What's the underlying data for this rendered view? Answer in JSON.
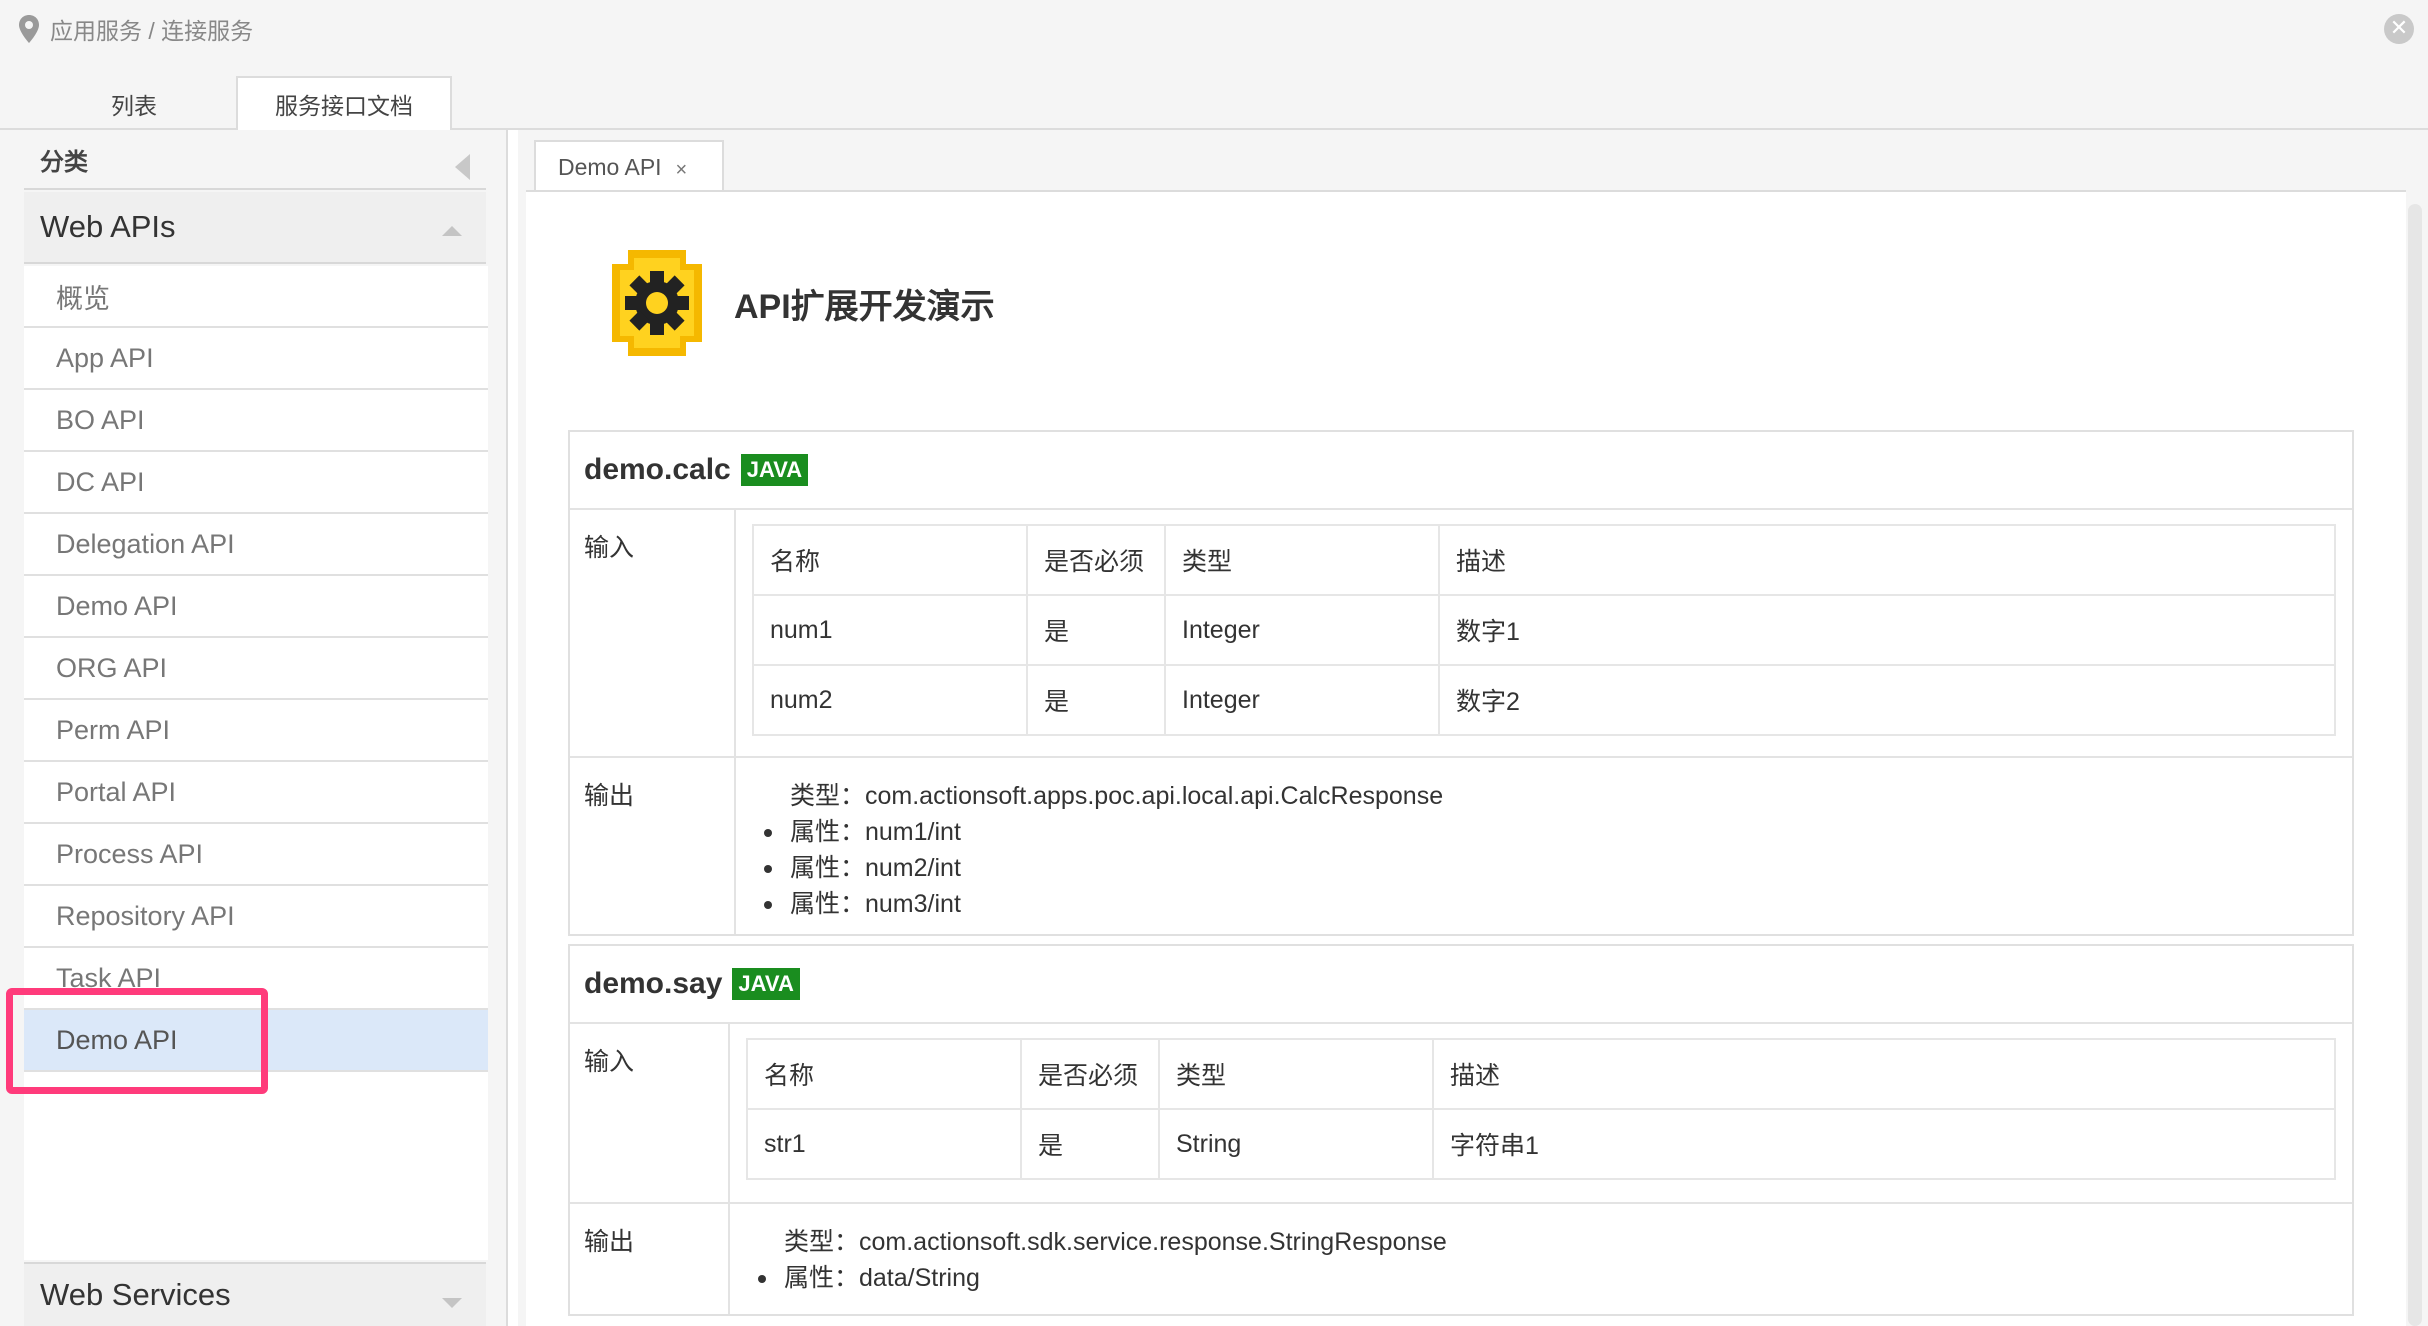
{
  "breadcrumb": {
    "text": "应用服务 / 连接服务",
    "icon": "location-pin-icon"
  },
  "window": {
    "close_icon": "close-circle-icon"
  },
  "tabs": [
    {
      "label": "列表"
    },
    {
      "label": "服务接口文档"
    }
  ],
  "sidebar": {
    "category_title": "分类",
    "group_open": "Web APIs",
    "items": [
      {
        "label": "概览"
      },
      {
        "label": "App API"
      },
      {
        "label": "BO API"
      },
      {
        "label": "DC API"
      },
      {
        "label": "Delegation API"
      },
      {
        "label": "Demo API"
      },
      {
        "label": "ORG API"
      },
      {
        "label": "Perm API"
      },
      {
        "label": "Portal API"
      },
      {
        "label": "Process API"
      },
      {
        "label": "Repository API"
      },
      {
        "label": "Task API"
      },
      {
        "label": "Demo API"
      }
    ],
    "selected_index": 12,
    "group_closed": "Web Services"
  },
  "content": {
    "doc_tab": {
      "label": "Demo API",
      "close": "×"
    },
    "api_title": "API扩展开发演示",
    "api_icon": "gear-icon",
    "badge_color": "#1a8d1f",
    "methods": [
      {
        "name": "demo.calc",
        "badge": "JAVA",
        "input_label": "输入",
        "output_label": "输出",
        "columns": [
          "名称",
          "是否必须",
          "类型",
          "描述"
        ],
        "params": [
          {
            "name": "num1",
            "required": "是",
            "type": "Integer",
            "desc": "数字1"
          },
          {
            "name": "num2",
            "required": "是",
            "type": "Integer",
            "desc": "数字2"
          }
        ],
        "output": [
          "类型：com.actionsoft.apps.poc.api.local.api.CalcResponse",
          "属性：num1/int",
          "属性：num2/int",
          "属性：num3/int"
        ]
      },
      {
        "name": "demo.say",
        "badge": "JAVA",
        "input_label": "输入",
        "output_label": "输出",
        "columns": [
          "名称",
          "是否必须",
          "类型",
          "描述"
        ],
        "params": [
          {
            "name": "str1",
            "required": "是",
            "type": "String",
            "desc": "字符串1"
          }
        ],
        "output": [
          "类型：com.actionsoft.sdk.service.response.StringResponse",
          "属性：data/String"
        ]
      }
    ]
  }
}
